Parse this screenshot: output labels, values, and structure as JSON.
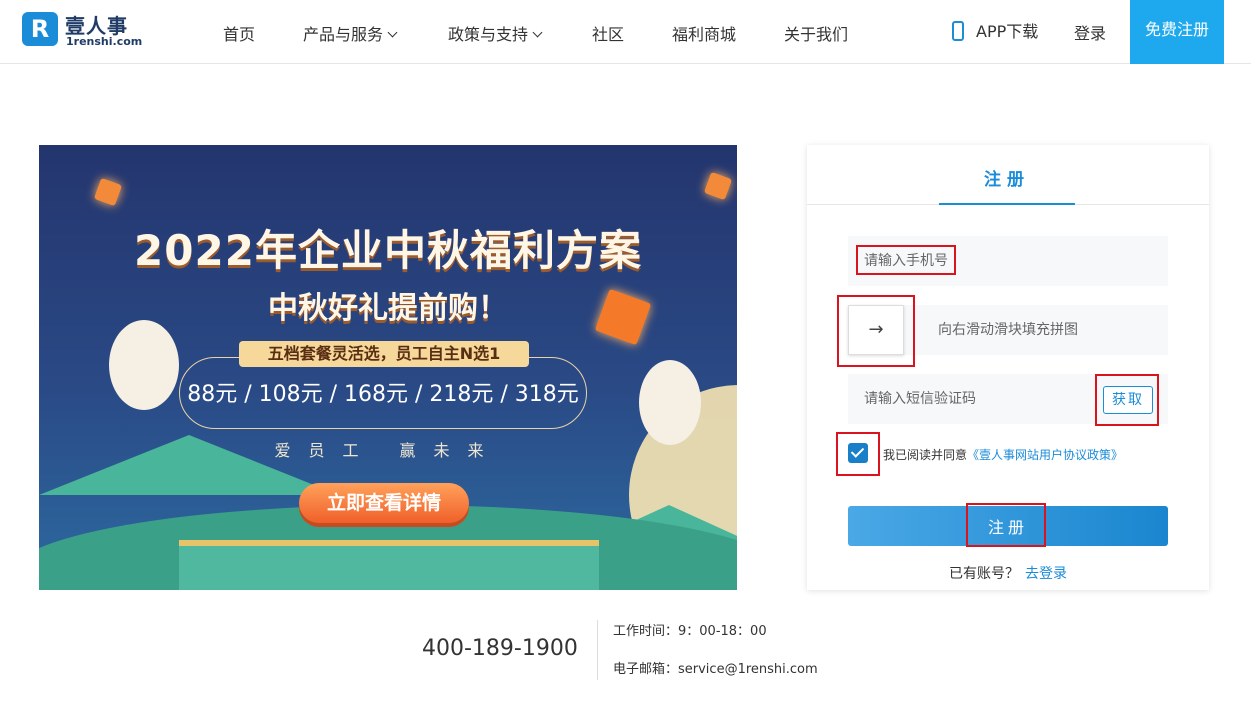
{
  "header": {
    "logo_text": "壹人事",
    "logo_sub": "1renshi.com",
    "logo_mark": "R",
    "nav": [
      {
        "label": "首页",
        "dropdown": false
      },
      {
        "label": "产品与服务",
        "dropdown": true
      },
      {
        "label": "政策与支持",
        "dropdown": true
      },
      {
        "label": "社区",
        "dropdown": false
      },
      {
        "label": "福利商城",
        "dropdown": false
      },
      {
        "label": "关于我们",
        "dropdown": false
      }
    ],
    "app_download": "APP下载",
    "login": "登录",
    "register": "免费注册"
  },
  "banner": {
    "title": "2022年企业中秋福利方案",
    "subtitle": "中秋好礼提前购！",
    "pill": "五档套餐灵活选，员工自主N选1",
    "prices": "88元 / 108元 / 168元 / 218元 / 318元",
    "slogan": "爱员工  赢未来",
    "cta": "立即查看详情"
  },
  "form": {
    "tab": "注册",
    "phone_placeholder": "请输入手机号",
    "slider_arrow": "→",
    "slider_text": "向右滑动滑块填充拼图",
    "sms_placeholder": "请输入短信验证码",
    "get_code": "获取",
    "agree_checked": true,
    "agree_text": "我已阅读并同意",
    "agree_link": "《壹人事网站用户协议政策》",
    "submit": "注册",
    "have_account": "已有账号？",
    "go_login": "去登录"
  },
  "footer": {
    "hotline": "400-189-1900",
    "work_hours": "工作时间：9：00-18：00",
    "email": "电子邮箱：service@1renshi.com"
  },
  "colors": {
    "brand_blue": "#1a8cd8",
    "register_bg": "#1ea9ee",
    "annotation_red": "#d9141f"
  }
}
